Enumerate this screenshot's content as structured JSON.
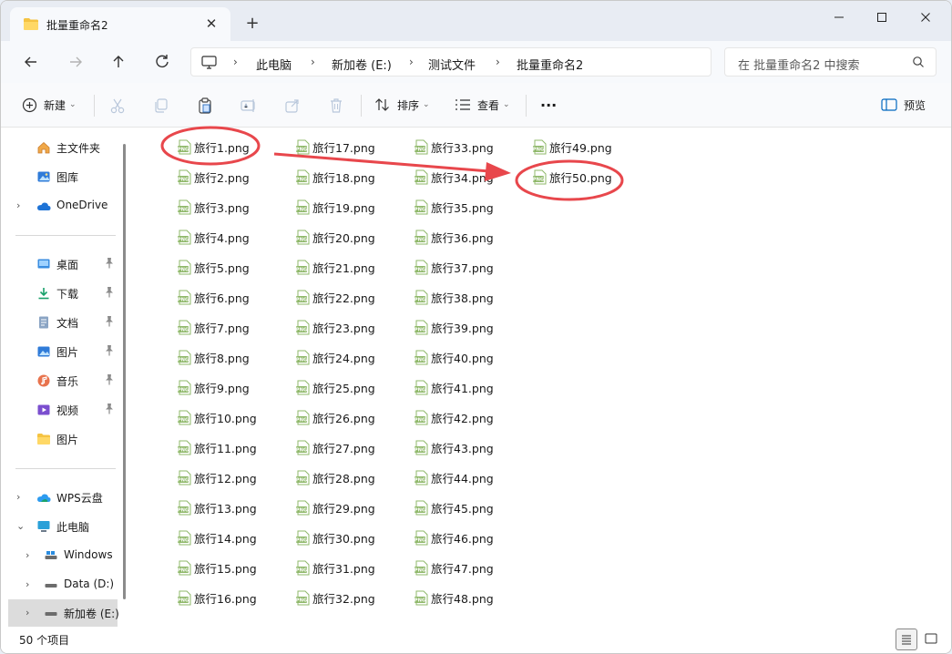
{
  "window": {
    "tab_title": "批量重命名2",
    "new_tab": "+",
    "tab_close": "✕"
  },
  "nav": {
    "breadcrumbs": [
      "此电脑",
      "新加卷 (E:)",
      "测试文件",
      "批量重命名2"
    ],
    "search_placeholder": "在 批量重命名2 中搜索"
  },
  "toolbar": {
    "new_label": "新建",
    "sort_label": "排序",
    "view_label": "查看",
    "more_label": "···",
    "preview_label": "预览"
  },
  "sidebar": {
    "quick": [
      {
        "label": "主文件夹",
        "icon": "home-icon"
      },
      {
        "label": "图库",
        "icon": "gallery-icon"
      },
      {
        "label": "OneDrive",
        "icon": "onedrive-cloud-icon"
      }
    ],
    "pinned": [
      {
        "label": "桌面",
        "icon": "desktop-icon"
      },
      {
        "label": "下载",
        "icon": "download-icon"
      },
      {
        "label": "文档",
        "icon": "document-icon"
      },
      {
        "label": "图片",
        "icon": "pictures-icon"
      },
      {
        "label": "音乐",
        "icon": "music-icon"
      },
      {
        "label": "视频",
        "icon": "video-icon"
      },
      {
        "label": "图片",
        "icon": "folder-icon"
      }
    ],
    "drives": [
      {
        "label": "WPS云盘",
        "icon": "wps-cloud-icon"
      },
      {
        "label": "此电脑",
        "icon": "this-pc-icon"
      },
      {
        "label": "Windows",
        "icon": "drive-icon"
      },
      {
        "label": "Data (D:)",
        "icon": "drive-icon"
      },
      {
        "label": "新加卷 (E:)",
        "icon": "drive-icon"
      }
    ]
  },
  "files": {
    "col1": [
      "旅行1.png",
      "旅行2.png",
      "旅行3.png",
      "旅行4.png",
      "旅行5.png",
      "旅行6.png",
      "旅行7.png",
      "旅行8.png",
      "旅行9.png",
      "旅行10.png",
      "旅行11.png",
      "旅行12.png",
      "旅行13.png",
      "旅行14.png",
      "旅行15.png",
      "旅行16.png"
    ],
    "col2": [
      "旅行17.png",
      "旅行18.png",
      "旅行19.png",
      "旅行20.png",
      "旅行21.png",
      "旅行22.png",
      "旅行23.png",
      "旅行24.png",
      "旅行25.png",
      "旅行26.png",
      "旅行27.png",
      "旅行28.png",
      "旅行29.png",
      "旅行30.png",
      "旅行31.png",
      "旅行32.png"
    ],
    "col3": [
      "旅行33.png",
      "旅行34.png",
      "旅行35.png",
      "旅行36.png",
      "旅行37.png",
      "旅行38.png",
      "旅行39.png",
      "旅行40.png",
      "旅行41.png",
      "旅行42.png",
      "旅行43.png",
      "旅行44.png",
      "旅行45.png",
      "旅行46.png",
      "旅行47.png",
      "旅行48.png"
    ],
    "col4": [
      "旅行49.png",
      "旅行50.png"
    ],
    "icon_text": "PNG"
  },
  "status": {
    "item_count": "50 个项目"
  },
  "colors": {
    "annotation": "#e8474c",
    "png_icon": "#8fb86a",
    "accent": "#0067c0"
  }
}
